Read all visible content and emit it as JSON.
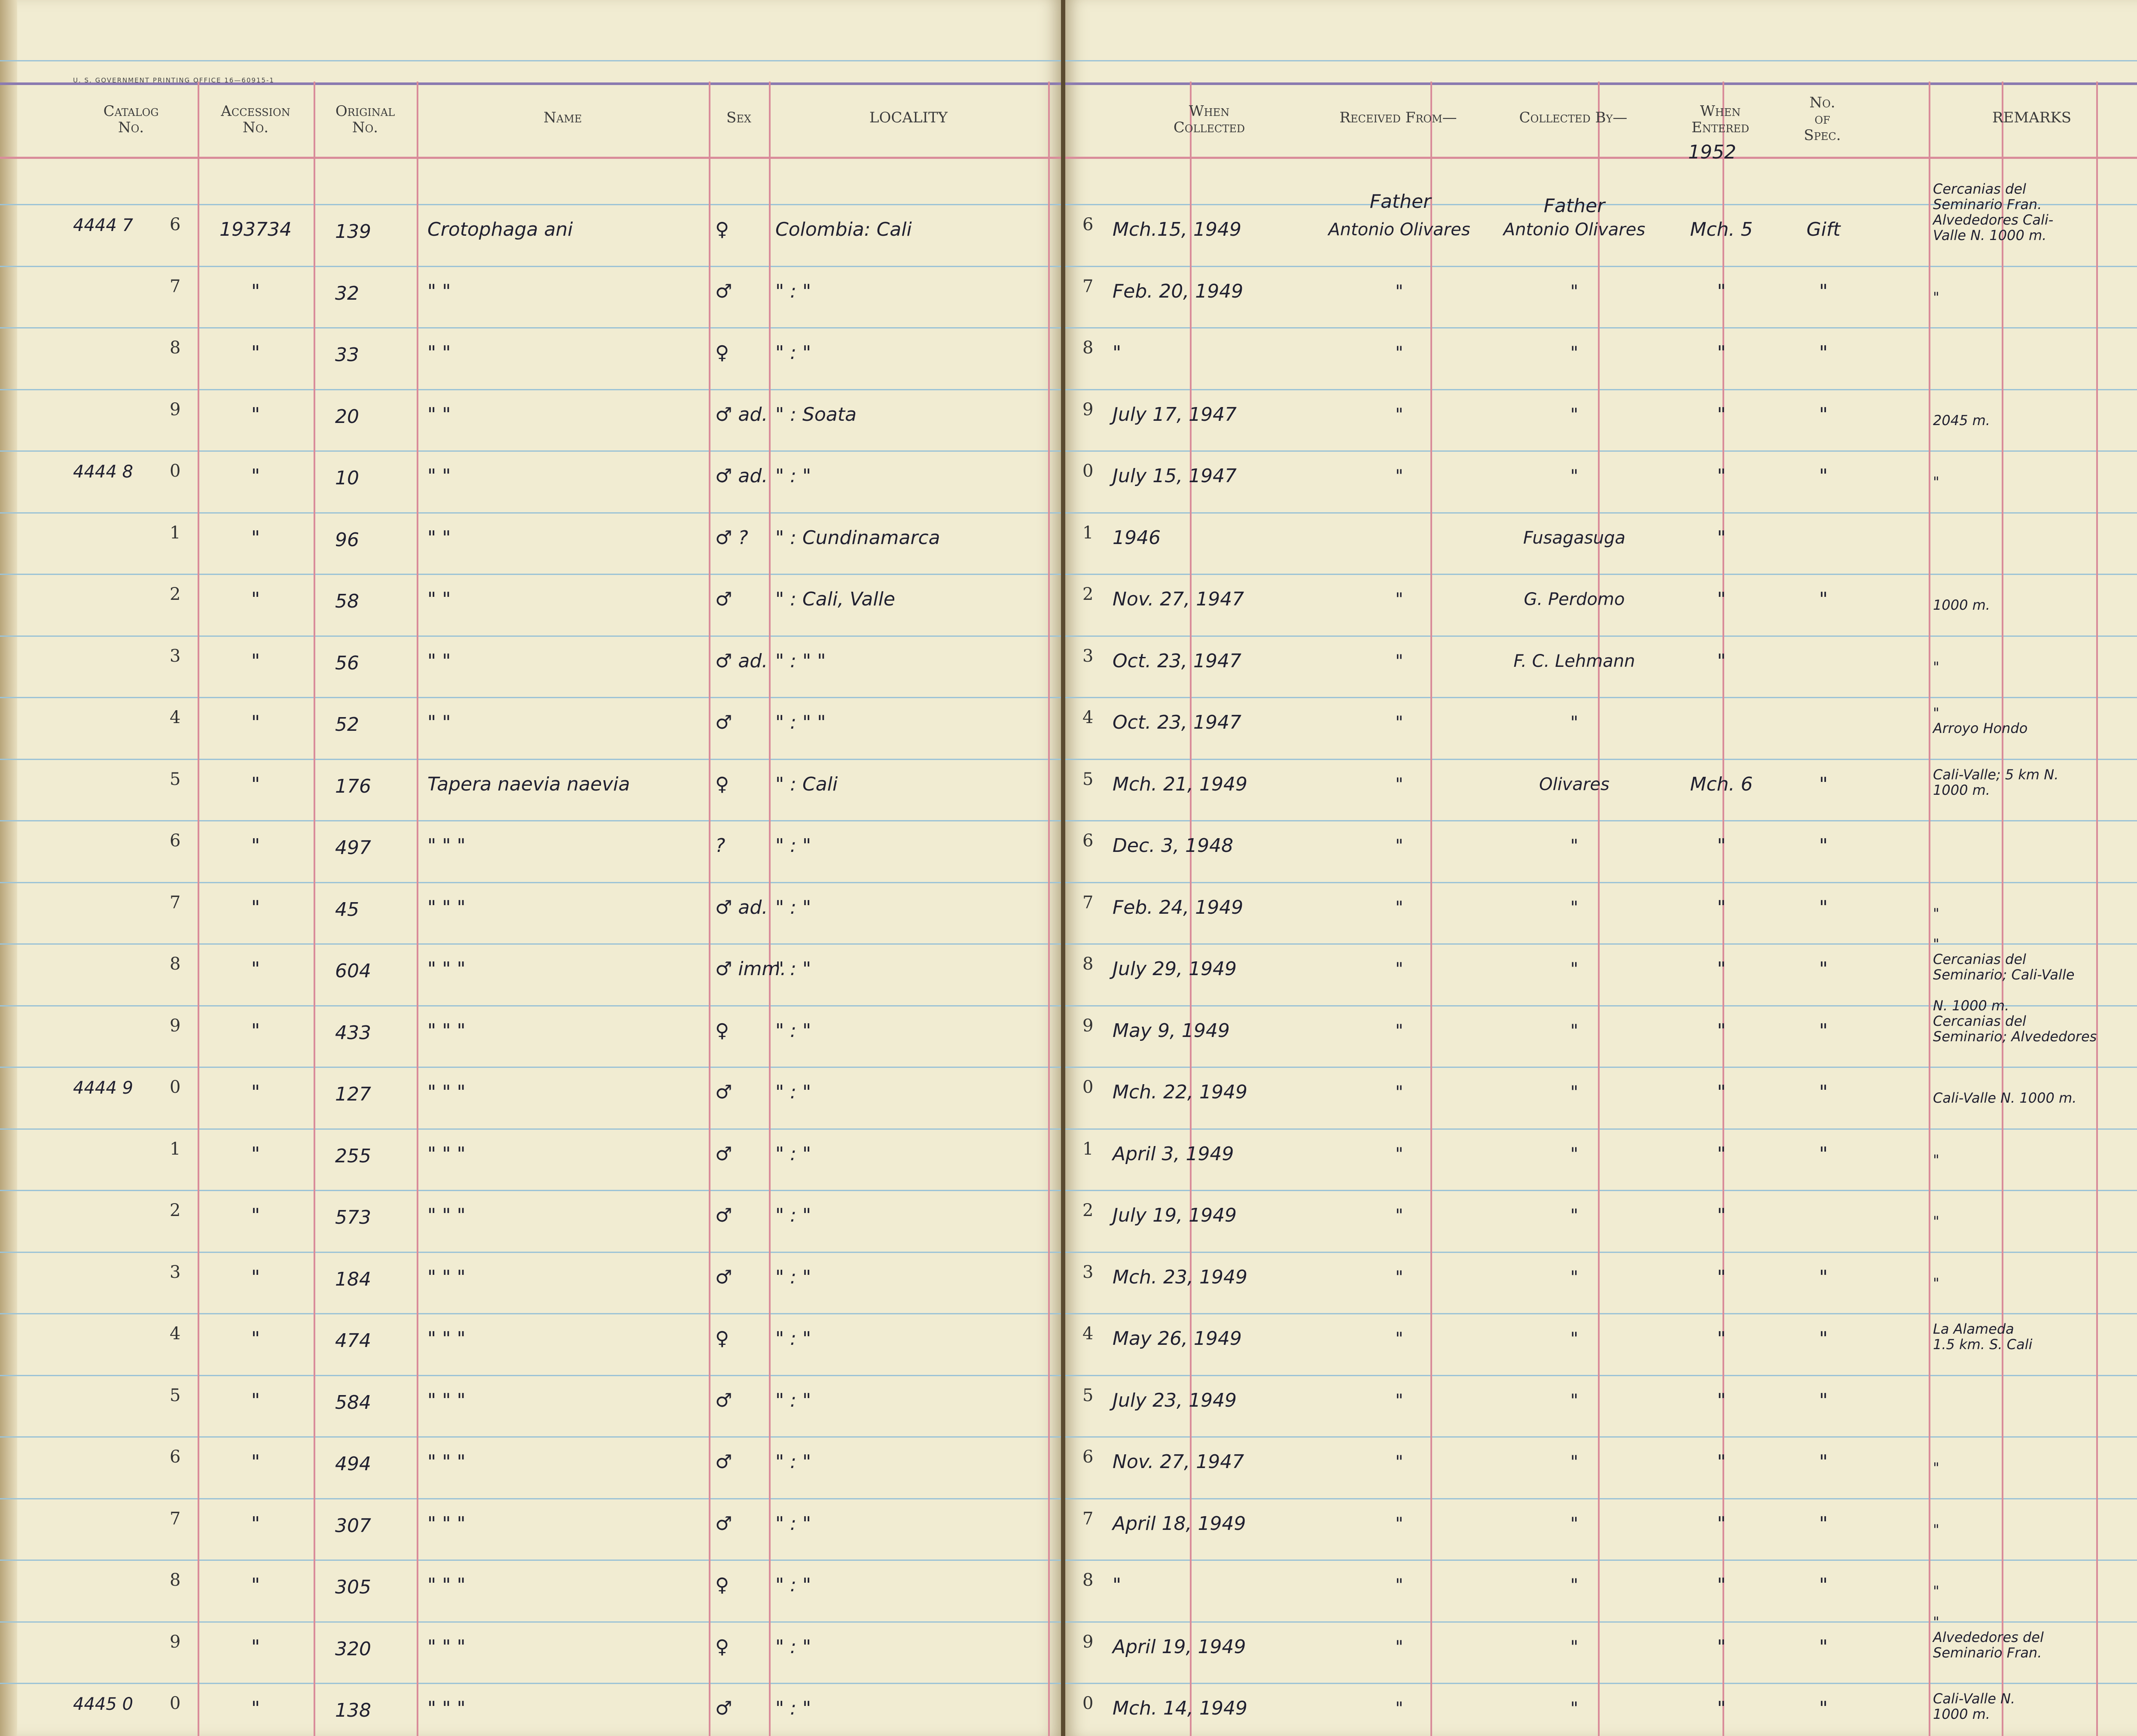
{
  "imprint": "U. S. GOVERNMENT PRINTING OFFICE    16—60915-1",
  "headers": {
    "catalog": [
      "Catalog",
      "No."
    ],
    "accession": [
      "Accession",
      "No."
    ],
    "original": [
      "Original",
      "No."
    ],
    "name": "Name",
    "sex": "Sex",
    "locality": "LOCALITY",
    "when_collected": [
      "When",
      "Collected"
    ],
    "received_from": "Received From—",
    "collected_by": "Collected By—",
    "when_entered": [
      "When",
      "Entered"
    ],
    "no_of_spec": [
      "No.",
      "of",
      "Spec."
    ],
    "remarks": "REMARKS"
  },
  "entered_year": "1952",
  "rows": [
    {
      "catalog": "4444 7",
      "digit": "6",
      "accession": "193734",
      "original": "139",
      "name": "Crotophaga ani",
      "sex": "♀",
      "locality": "Colombia: Cali",
      "rdigit": "6",
      "when": "Mch.15, 1949",
      "received": "Antonio Olivares",
      "received_top": "Father",
      "collector": "Antonio Olivares",
      "collector_top": "Father",
      "entered": "Mch. 5",
      "spec": "Gift",
      "remarks": [
        "Cercanias del",
        "Seminario Fran.",
        "Alvededores Cali-",
        "Valle N.     1000 m."
      ]
    },
    {
      "catalog": "",
      "digit": "7",
      "accession": "\"",
      "original": "32",
      "name": "\"        \"",
      "sex": "♂",
      "locality": "\"    :    \"",
      "rdigit": "7",
      "when": "Feb. 20, 1949",
      "received": "\"",
      "received_top": "",
      "collector": "\"",
      "collector_top": "",
      "entered": "\"",
      "spec": "\"",
      "remarks": [
        "\""
      ]
    },
    {
      "catalog": "",
      "digit": "8",
      "accession": "\"",
      "original": "33",
      "name": "\"        \"",
      "sex": "♀",
      "locality": "\"    :    \"",
      "rdigit": "8",
      "when": "\"",
      "received": "\"",
      "received_top": "",
      "collector": "\"",
      "collector_top": "",
      "entered": "\"",
      "spec": "\"",
      "remarks": []
    },
    {
      "catalog": "",
      "digit": "9",
      "accession": "\"",
      "original": "20",
      "name": "\"        \"",
      "sex": "♂ ad.",
      "locality": "\"  : Soata",
      "rdigit": "9",
      "when": "July 17, 1947",
      "received": "\"",
      "received_top": "",
      "collector": "\"",
      "collector_top": "",
      "entered": "\"",
      "spec": "\"",
      "remarks": [
        "2045 m."
      ]
    },
    {
      "catalog": "4444 8",
      "digit": "0",
      "accession": "\"",
      "original": "10",
      "name": "\"        \"",
      "sex": "♂ ad.",
      "locality": "\"    :    \"",
      "rdigit": "0",
      "when": "July 15, 1947",
      "received": "\"",
      "received_top": "",
      "collector": "\"",
      "collector_top": "",
      "entered": "\"",
      "spec": "\"",
      "remarks": [
        "\""
      ]
    },
    {
      "catalog": "",
      "digit": "1",
      "accession": "\"",
      "original": "96",
      "name": "\"        \"",
      "sex": "♂ ?",
      "locality": "\" : Cundinamarca",
      "rdigit": "1",
      "when": "1946",
      "received": "",
      "received_top": "",
      "collector": "Fusagasuga",
      "collector_top": "",
      "entered": "\"",
      "spec": "",
      "remarks": []
    },
    {
      "catalog": "",
      "digit": "2",
      "accession": "\"",
      "original": "58",
      "name": "\"        \"",
      "sex": "♂",
      "locality": "\" : Cali, Valle",
      "rdigit": "2",
      "when": "Nov. 27, 1947",
      "received": "\"",
      "received_top": "",
      "collector": "G. Perdomo",
      "collector_top": "",
      "entered": "\"",
      "spec": "\"",
      "remarks": [
        "1000 m."
      ]
    },
    {
      "catalog": "",
      "digit": "3",
      "accession": "\"",
      "original": "56",
      "name": "\"        \"",
      "sex": "♂ ad.",
      "locality": "\" :    \"    \"",
      "rdigit": "3",
      "when": "Oct. 23, 1947",
      "received": "\"",
      "received_top": "",
      "collector": "F. C. Lehmann",
      "collector_top": "",
      "entered": "\"",
      "spec": "",
      "remarks": [
        "\""
      ]
    },
    {
      "catalog": "",
      "digit": "4",
      "accession": "\"",
      "original": "52",
      "name": "\"        \"",
      "sex": "♂",
      "locality": "\" :    \"    \"",
      "rdigit": "4",
      "when": "Oct. 23, 1947",
      "received": "\"",
      "received_top": "",
      "collector": "\"",
      "collector_top": "",
      "entered": "",
      "spec": "",
      "remarks": [
        "\"",
        "Arroyo Hondo"
      ]
    },
    {
      "catalog": "",
      "digit": "5",
      "accession": "\"",
      "original": "176",
      "name": "Tapera naevia naevia",
      "sex": "♀",
      "locality": "\" :     Cali",
      "rdigit": "5",
      "when": "Mch. 21, 1949",
      "received": "\"",
      "received_top": "",
      "collector": "Olivares",
      "collector_top": "",
      "entered": "Mch. 6",
      "spec": "\"",
      "remarks": [
        "Cali-Valle; 5 km N.",
        "1000 m."
      ]
    },
    {
      "catalog": "",
      "digit": "6",
      "accession": "\"",
      "original": "497",
      "name": "\"         \"         \"",
      "sex": "?",
      "locality": "\"    :    \"",
      "rdigit": "6",
      "when": "Dec. 3, 1948",
      "received": "\"",
      "received_top": "",
      "collector": "\"",
      "collector_top": "",
      "entered": "\"",
      "spec": "\"",
      "remarks": []
    },
    {
      "catalog": "",
      "digit": "7",
      "accession": "\"",
      "original": "45",
      "name": "\"         \"         \"",
      "sex": "♂ ad.",
      "locality": "\"    :    \"",
      "rdigit": "7",
      "when": "Feb. 24, 1949",
      "received": "\"",
      "received_top": "",
      "collector": "\"",
      "collector_top": "",
      "entered": "\"",
      "spec": "\"",
      "remarks": [
        "\""
      ]
    },
    {
      "catalog": "",
      "digit": "8",
      "accession": "\"",
      "original": "604",
      "name": "\"         \"         \"",
      "sex": "♂ imm.",
      "locality": "\"    :    \"",
      "rdigit": "8",
      "when": "July 29, 1949",
      "received": "\"",
      "received_top": "",
      "collector": "\"",
      "collector_top": "",
      "entered": "\"",
      "spec": "\"",
      "remarks": [
        "\"",
        "Cercanias del",
        "Seminario; Cali-Valle"
      ]
    },
    {
      "catalog": "",
      "digit": "9",
      "accession": "\"",
      "original": "433",
      "name": "\"         \"         \"",
      "sex": "♀",
      "locality": "\"    :    \"",
      "rdigit": "9",
      "when": "May 9, 1949",
      "received": "\"",
      "received_top": "",
      "collector": "\"",
      "collector_top": "",
      "entered": "\"",
      "spec": "\"",
      "remarks": [
        "N.          1000 m.",
        "Cercanias del",
        "Seminario; Alvededores"
      ]
    },
    {
      "catalog": "4444 9",
      "digit": "0",
      "accession": "\"",
      "original": "127",
      "name": "\"         \"         \"",
      "sex": "♂",
      "locality": "\"    :    \"",
      "rdigit": "0",
      "when": "Mch. 22, 1949",
      "received": "\"",
      "received_top": "",
      "collector": "\"",
      "collector_top": "",
      "entered": "\"",
      "spec": "\"",
      "remarks": [
        "Cali-Valle N.     1000 m."
      ]
    },
    {
      "catalog": "",
      "digit": "1",
      "accession": "\"",
      "original": "255",
      "name": "\"         \"         \"",
      "sex": "♂",
      "locality": "\"    :    \"",
      "rdigit": "1",
      "when": "April 3, 1949",
      "received": "\"",
      "received_top": "",
      "collector": "\"",
      "collector_top": "",
      "entered": "\"",
      "spec": "\"",
      "remarks": [
        "\""
      ]
    },
    {
      "catalog": "",
      "digit": "2",
      "accession": "\"",
      "original": "573",
      "name": "\"         \"         \"",
      "sex": "♂",
      "locality": "\"    :    \"",
      "rdigit": "2",
      "when": "July 19, 1949",
      "received": "\"",
      "received_top": "",
      "collector": "\"",
      "collector_top": "",
      "entered": "\"",
      "spec": "",
      "remarks": [
        "\""
      ]
    },
    {
      "catalog": "",
      "digit": "3",
      "accession": "\"",
      "original": "184",
      "name": "\"         \"         \"",
      "sex": "♂",
      "locality": "\"    :    \"",
      "rdigit": "3",
      "when": "Mch. 23, 1949",
      "received": "\"",
      "received_top": "",
      "collector": "\"",
      "collector_top": "",
      "entered": "\"",
      "spec": "\"",
      "remarks": [
        "\""
      ]
    },
    {
      "catalog": "",
      "digit": "4",
      "accession": "\"",
      "original": "474",
      "name": "\"         \"         \"",
      "sex": "♀",
      "locality": "\"    :    \"",
      "rdigit": "4",
      "when": "May 26, 1949",
      "received": "\"",
      "received_top": "",
      "collector": "\"",
      "collector_top": "",
      "entered": "\"",
      "spec": "\"",
      "remarks": [
        "La Alameda",
        "1.5 km. S. Cali"
      ]
    },
    {
      "catalog": "",
      "digit": "5",
      "accession": "\"",
      "original": "584",
      "name": "\"         \"         \"",
      "sex": "♂",
      "locality": "\"    :    \"",
      "rdigit": "5",
      "when": "July 23, 1949",
      "received": "\"",
      "received_top": "",
      "collector": "\"",
      "collector_top": "",
      "entered": "\"",
      "spec": "\"",
      "remarks": []
    },
    {
      "catalog": "",
      "digit": "6",
      "accession": "\"",
      "original": "494",
      "name": "\"         \"         \"",
      "sex": "♂",
      "locality": "\"    :    \"",
      "rdigit": "6",
      "when": "Nov. 27, 1947",
      "received": "\"",
      "received_top": "",
      "collector": "\"",
      "collector_top": "",
      "entered": "\"",
      "spec": "\"",
      "remarks": [
        "\""
      ]
    },
    {
      "catalog": "",
      "digit": "7",
      "accession": "\"",
      "original": "307",
      "name": "\"         \"         \"",
      "sex": "♂",
      "locality": "\"    :    \"",
      "rdigit": "7",
      "when": "April 18, 1949",
      "received": "\"",
      "received_top": "",
      "collector": "\"",
      "collector_top": "",
      "entered": "\"",
      "spec": "\"",
      "remarks": [
        "\""
      ]
    },
    {
      "catalog": "",
      "digit": "8",
      "accession": "\"",
      "original": "305",
      "name": "\"         \"         \"",
      "sex": "♀",
      "locality": "\"    :    \"",
      "rdigit": "8",
      "when": "\"",
      "received": "\"",
      "received_top": "",
      "collector": "\"",
      "collector_top": "",
      "entered": "\"",
      "spec": "\"",
      "remarks": [
        "\""
      ]
    },
    {
      "catalog": "",
      "digit": "9",
      "accession": "\"",
      "original": "320",
      "name": "\"         \"         \"",
      "sex": "♀",
      "locality": "\"    :    \"",
      "rdigit": "9",
      "when": "April 19, 1949",
      "received": "\"",
      "received_top": "",
      "collector": "\"",
      "collector_top": "",
      "entered": "\"",
      "spec": "\"",
      "remarks": [
        "\"",
        "Alvededores del",
        "Seminario Fran."
      ]
    },
    {
      "catalog": "4445 0",
      "digit": "0",
      "accession": "\"",
      "original": "138",
      "name": "\"         \"         \"",
      "sex": "♂",
      "locality": "\"    :    \"",
      "rdigit": "0",
      "when": "Mch. 14, 1949",
      "received": "\"",
      "received_top": "",
      "collector": "\"",
      "collector_top": "",
      "entered": "\"",
      "spec": "\"",
      "remarks": [
        "Cali-Valle N.",
        "1000 m."
      ]
    }
  ]
}
